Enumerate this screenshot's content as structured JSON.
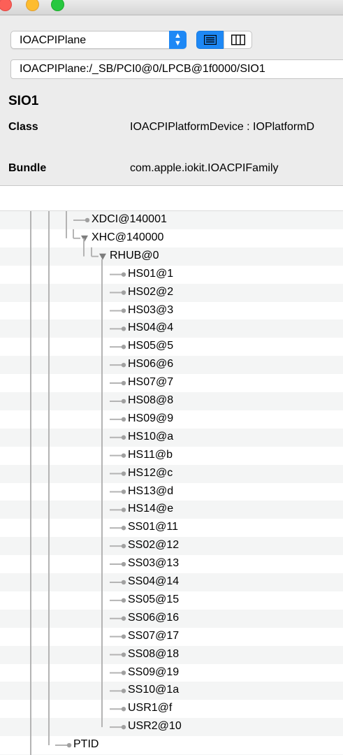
{
  "window": {
    "traffic_lights": {
      "close": "#fc5f57",
      "minimize": "#fdbc2e",
      "maximize": "#28c840"
    }
  },
  "toolbar": {
    "plane": "IOACPIPlane",
    "view_mode": "list",
    "accent_color": "#1e88f5"
  },
  "path": "IOACPIPlane:/_SB/PCI0@0/LPCB@1f0000/SIO1",
  "inspector": {
    "title": "SIO1",
    "class_key": "Class",
    "class_value": "IOACPIPlatformDevice : IOPlatformD",
    "bundle_key": "Bundle",
    "bundle_value": "com.apple.iokit.IOACPIFamily"
  },
  "tree": {
    "top_nodes": [
      {
        "label": "XDCI@140001",
        "kind": "leaf"
      },
      {
        "label": "XHC@140000",
        "kind": "expanded"
      },
      {
        "label": "RHUB@0",
        "kind": "expanded"
      }
    ],
    "ports": [
      "HS01@1",
      "HS02@2",
      "HS03@3",
      "HS04@4",
      "HS05@5",
      "HS06@6",
      "HS07@7",
      "HS08@8",
      "HS09@9",
      "HS10@a",
      "HS11@b",
      "HS12@c",
      "HS13@d",
      "HS14@e",
      "SS01@11",
      "SS02@12",
      "SS03@13",
      "SS04@14",
      "SS05@15",
      "SS06@16",
      "SS07@17",
      "SS08@18",
      "SS09@19",
      "SS10@1a",
      "USR1@f",
      "USR2@10"
    ],
    "bottom_nodes": [
      {
        "label": "PTID",
        "kind": "leaf"
      }
    ]
  }
}
